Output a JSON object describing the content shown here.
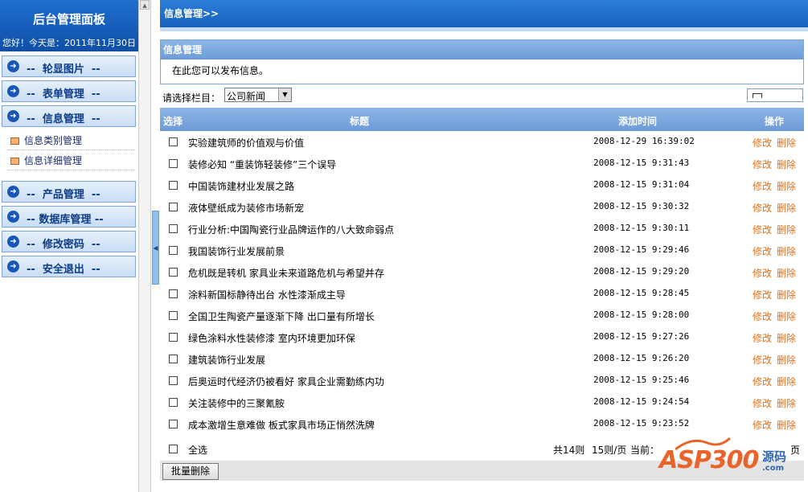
{
  "sidebar": {
    "title": "后台管理面板",
    "greeting": "您好！今天是：2011年11月30日",
    "menu": [
      {
        "label": "--  轮显图片  --"
      },
      {
        "label": "--  表单管理  --"
      },
      {
        "label": "--  信息管理  --"
      },
      {
        "label": "--  产品管理  --"
      },
      {
        "label": "-- 数据库管理 --"
      },
      {
        "label": "--  修改密码  --"
      },
      {
        "label": "--  安全退出  --"
      }
    ],
    "submenu": [
      {
        "label": "信息类别管理"
      },
      {
        "label": "信息详细管理"
      }
    ]
  },
  "header": {
    "breadcrumb": "信息管理>>"
  },
  "info": {
    "title": "信息管理",
    "text": "在此您可以发布信息。"
  },
  "filter": {
    "label": "请选择栏目：",
    "selected": "公司新闻"
  },
  "table": {
    "columns": {
      "select": "选择",
      "title": "标题",
      "time": "添加时间",
      "action": "操作"
    },
    "edit_label": "修改",
    "delete_label": "删除",
    "rows": [
      {
        "title": "实验建筑师的价值观与价值",
        "time": "2008-12-29 16:39:02"
      },
      {
        "title": "装修必知 “重装饰轻装修”三个误导",
        "time": "2008-12-15 9:31:43"
      },
      {
        "title": "中国装饰建材业发展之路",
        "time": "2008-12-15 9:31:04"
      },
      {
        "title": "液体壁纸成为装修市场新宠",
        "time": "2008-12-15 9:30:32"
      },
      {
        "title": "行业分析:中国陶瓷行业品牌运作的八大致命弱点",
        "time": "2008-12-15 9:30:11"
      },
      {
        "title": "我国装饰行业发展前景",
        "time": "2008-12-15 9:29:46"
      },
      {
        "title": "危机既是转机 家具业未来道路危机与希望并存",
        "time": "2008-12-15 9:29:20"
      },
      {
        "title": "涂料新国标静待出台 水性漆渐成主导",
        "time": "2008-12-15 9:28:45"
      },
      {
        "title": "全国卫生陶瓷产量逐渐下降 出口量有所增长",
        "time": "2008-12-15 9:28:00"
      },
      {
        "title": "绿色涂料水性装修漆 室内环境更加环保",
        "time": "2008-12-15 9:27:26"
      },
      {
        "title": "建筑装饰行业发展",
        "time": "2008-12-15 9:26:20"
      },
      {
        "title": "后奥运时代经济仍被看好 家具企业需勤练内功",
        "time": "2008-12-15 9:25:46"
      },
      {
        "title": "关注装修中的三聚氰胺",
        "time": "2008-12-15 9:24:54"
      },
      {
        "title": "成本激增生意难做 板式家具市场正悄然洗牌",
        "time": "2008-12-15 9:23:52"
      }
    ]
  },
  "footer": {
    "select_all": "全选",
    "total": "共14则",
    "per_page": "15则/页",
    "current": "当前：",
    "page_suffix": "页",
    "batch_delete": "批量删除"
  },
  "watermark": {
    "brand": "ASP300",
    "cn": "源码",
    "domain": ".com"
  }
}
